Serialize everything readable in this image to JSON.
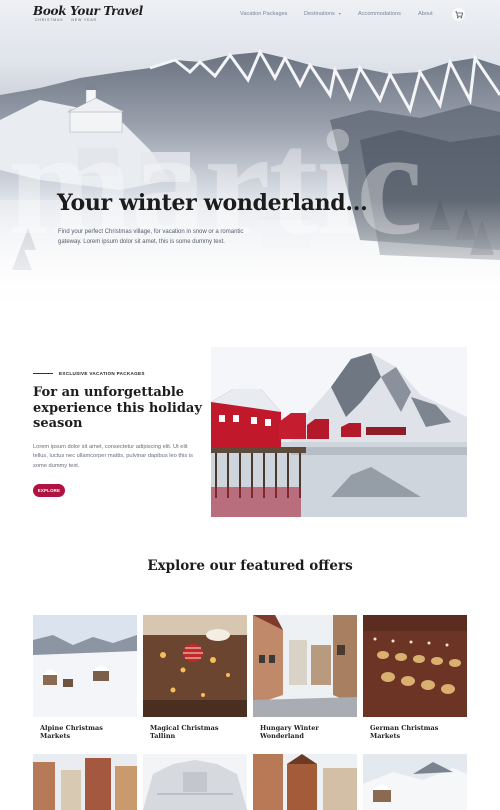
{
  "nav": {
    "logo_main": "Book Your Travel",
    "logo_sub_left": "CHRISTMAS",
    "logo_sub_right": "NEW YEAR",
    "links": [
      "Vacation Packages",
      "Destinations",
      "Accommodations",
      "About"
    ],
    "destinations_caret": "▾",
    "cart_icon": "cart-icon"
  },
  "hero": {
    "background_word": "martic",
    "title": "Your winter wonderland...",
    "text": "Find your perfect Christmas village, for vacation in snow or a romantic gateway. Lorem ipsum dolor sit amet, this is some dummy text."
  },
  "promo": {
    "eyebrow": "EXCLUSIVE VACATION PACKAGES",
    "title": "For an unforgettable experience this holiday season",
    "text": "Lorem ipsum dolor sit amet, consectetur adipiscing elit. Ut elit tellus, luctus nec ullamcorper mattis, pulvinar dapibus leo this is some dummy text.",
    "button": "EXPLORE"
  },
  "featured": {
    "title": "Explore our featured offers",
    "offers": [
      {
        "label": "Alpine Christmas Markets"
      },
      {
        "label": "Magical Christmas Tallinn"
      },
      {
        "label": "Hungary Winter Wonderland"
      },
      {
        "label": "German Christmas Markets"
      }
    ]
  },
  "colors": {
    "accent": "#b01241",
    "nav_text": "#7b8699",
    "heading": "#1c1c1c"
  }
}
